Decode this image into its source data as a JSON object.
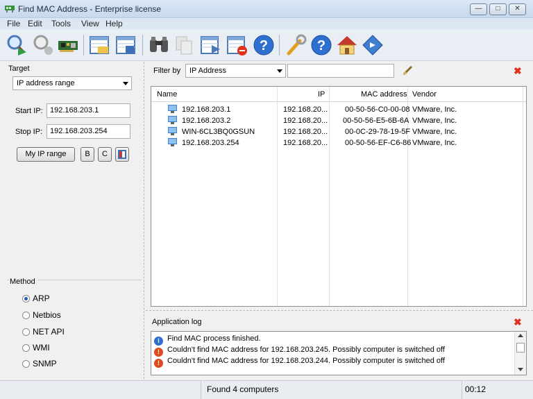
{
  "window": {
    "title": "Find MAC Address - Enterprise license",
    "controls": [
      "minimize",
      "restore",
      "close"
    ]
  },
  "menu": [
    "File",
    "Edit",
    "Tools",
    "View",
    "Help"
  ],
  "toolbar": {
    "icons": [
      "start-scan-icon",
      "stop-scan-icon",
      "network-card-icon",
      "open-list-icon",
      "save-list-icon",
      "find-icon",
      "copy-icon",
      "export-icon",
      "delete-icon",
      "help-icon",
      "settings-icon",
      "help-icon",
      "home-icon",
      "register-icon"
    ]
  },
  "target": {
    "label": "Target",
    "mode": "IP address range",
    "start_label": "Start IP:",
    "start_value": "192.168.203.1",
    "stop_label": "Stop IP:",
    "stop_value": "192.168.203.254",
    "buttons": {
      "my_ip_range": "My IP range",
      "b": "B",
      "c": "C"
    }
  },
  "method": {
    "label": "Method",
    "options": [
      {
        "label": "ARP",
        "selected": true
      },
      {
        "label": "Netbios",
        "selected": false
      },
      {
        "label": "NET API",
        "selected": false
      },
      {
        "label": "WMI",
        "selected": false
      },
      {
        "label": "SNMP",
        "selected": false
      }
    ]
  },
  "filter": {
    "label": "Filter by",
    "field": "IP Address",
    "value": ""
  },
  "results": {
    "columns": [
      "Name",
      "IP",
      "MAC address",
      "Vendor"
    ],
    "rows": [
      {
        "name": "192.168.203.1",
        "ip": "192.168.20...",
        "mac": "00-50-56-C0-00-08",
        "vendor": "VMware, Inc."
      },
      {
        "name": "192.168.203.2",
        "ip": "192.168.20...",
        "mac": "00-50-56-E5-6B-6A",
        "vendor": "VMware, Inc."
      },
      {
        "name": "WIN-6CL3BQ0GSUN",
        "ip": "192.168.20...",
        "mac": "00-0C-29-78-19-5F",
        "vendor": "VMware, Inc."
      },
      {
        "name": "192.168.203.254",
        "ip": "192.168.20...",
        "mac": "00-50-56-EF-C6-86",
        "vendor": "VMware, Inc."
      }
    ]
  },
  "log": {
    "label": "Application log",
    "lines": [
      {
        "type": "info",
        "text": "Find MAC process finished."
      },
      {
        "type": "error",
        "text": "Couldn't find MAC address for 192.168.203.245. Possibly computer is switched off"
      },
      {
        "type": "error",
        "text": "Couldn't find MAC address for 192.168.203.244. Possibly computer is switched off"
      }
    ]
  },
  "status": {
    "message": "Found 4 computers",
    "time": "00:12"
  },
  "colors": {
    "info": "#2f6fd0",
    "error": "#e04a1e",
    "close_x": "#e0301e"
  }
}
